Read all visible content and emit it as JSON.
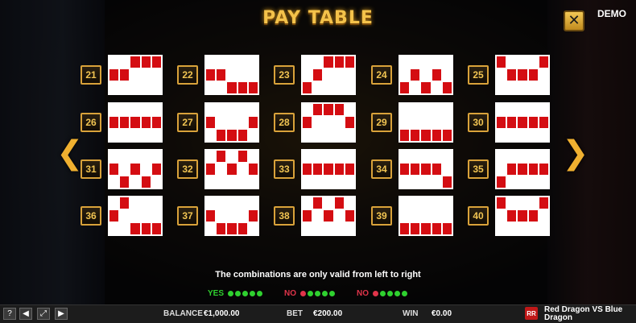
{
  "header": {
    "title": "PAY TABLE",
    "demo": "DEMO",
    "close_icon": "x-icon"
  },
  "nav": {
    "prev": "❮",
    "next": "❯"
  },
  "paylines": [
    {
      "n": "21",
      "grid": [
        [
          0,
          0,
          1,
          1,
          1
        ],
        [
          1,
          1,
          0,
          0,
          0
        ],
        [
          0,
          0,
          0,
          0,
          0
        ]
      ]
    },
    {
      "n": "22",
      "grid": [
        [
          0,
          0,
          0,
          0,
          0
        ],
        [
          1,
          1,
          0,
          0,
          0
        ],
        [
          0,
          0,
          1,
          1,
          1
        ]
      ]
    },
    {
      "n": "23",
      "grid": [
        [
          0,
          0,
          1,
          1,
          1
        ],
        [
          0,
          1,
          0,
          0,
          0
        ],
        [
          1,
          0,
          0,
          0,
          0
        ]
      ]
    },
    {
      "n": "24",
      "grid": [
        [
          0,
          0,
          0,
          0,
          0
        ],
        [
          0,
          1,
          0,
          1,
          0
        ],
        [
          1,
          0,
          1,
          0,
          1
        ]
      ]
    },
    {
      "n": "25",
      "grid": [
        [
          1,
          0,
          0,
          0,
          1
        ],
        [
          0,
          1,
          1,
          1,
          0
        ],
        [
          0,
          0,
          0,
          0,
          0
        ]
      ]
    },
    {
      "n": "26",
      "grid": [
        [
          0,
          0,
          0,
          0,
          0
        ],
        [
          1,
          1,
          1,
          1,
          1
        ],
        [
          0,
          0,
          0,
          0,
          0
        ]
      ]
    },
    {
      "n": "27",
      "grid": [
        [
          0,
          0,
          0,
          0,
          0
        ],
        [
          1,
          0,
          0,
          0,
          1
        ],
        [
          0,
          1,
          1,
          1,
          0
        ]
      ]
    },
    {
      "n": "28",
      "grid": [
        [
          0,
          1,
          1,
          1,
          0
        ],
        [
          1,
          0,
          0,
          0,
          1
        ],
        [
          0,
          0,
          0,
          0,
          0
        ]
      ]
    },
    {
      "n": "29",
      "grid": [
        [
          0,
          0,
          0,
          0,
          0
        ],
        [
          0,
          0,
          0,
          0,
          0
        ],
        [
          1,
          1,
          1,
          1,
          1
        ]
      ]
    },
    {
      "n": "30",
      "grid": [
        [
          0,
          0,
          0,
          0,
          0
        ],
        [
          1,
          1,
          1,
          1,
          1
        ],
        [
          0,
          0,
          0,
          0,
          0
        ]
      ]
    },
    {
      "n": "31",
      "grid": [
        [
          0,
          0,
          0,
          0,
          0
        ],
        [
          1,
          0,
          1,
          0,
          1
        ],
        [
          0,
          1,
          0,
          1,
          0
        ]
      ]
    },
    {
      "n": "32",
      "grid": [
        [
          0,
          1,
          0,
          1,
          0
        ],
        [
          1,
          0,
          1,
          0,
          1
        ],
        [
          0,
          0,
          0,
          0,
          0
        ]
      ]
    },
    {
      "n": "33",
      "grid": [
        [
          0,
          0,
          0,
          0,
          0
        ],
        [
          1,
          1,
          1,
          1,
          1
        ],
        [
          0,
          0,
          0,
          0,
          0
        ]
      ]
    },
    {
      "n": "34",
      "grid": [
        [
          0,
          0,
          0,
          0,
          0
        ],
        [
          1,
          1,
          1,
          1,
          0
        ],
        [
          0,
          0,
          0,
          0,
          1
        ]
      ]
    },
    {
      "n": "35",
      "grid": [
        [
          0,
          0,
          0,
          0,
          0
        ],
        [
          0,
          1,
          1,
          1,
          1
        ],
        [
          1,
          0,
          0,
          0,
          0
        ]
      ]
    },
    {
      "n": "36",
      "grid": [
        [
          0,
          1,
          0,
          0,
          0
        ],
        [
          1,
          0,
          0,
          0,
          0
        ],
        [
          0,
          0,
          1,
          1,
          1
        ]
      ]
    },
    {
      "n": "37",
      "grid": [
        [
          0,
          0,
          0,
          0,
          0
        ],
        [
          1,
          0,
          0,
          0,
          1
        ],
        [
          0,
          1,
          1,
          1,
          0
        ]
      ]
    },
    {
      "n": "38",
      "grid": [
        [
          0,
          1,
          0,
          1,
          0
        ],
        [
          1,
          0,
          1,
          0,
          1
        ],
        [
          0,
          0,
          0,
          0,
          0
        ]
      ]
    },
    {
      "n": "39",
      "grid": [
        [
          0,
          0,
          0,
          0,
          0
        ],
        [
          0,
          0,
          0,
          0,
          0
        ],
        [
          1,
          1,
          1,
          1,
          1
        ]
      ]
    },
    {
      "n": "40",
      "grid": [
        [
          1,
          0,
          0,
          0,
          1
        ],
        [
          0,
          1,
          1,
          1,
          0
        ],
        [
          0,
          0,
          0,
          0,
          0
        ]
      ]
    }
  ],
  "note": "The combinations are only valid from left to right",
  "examples": [
    {
      "label": "YES",
      "color": "#2fd12f",
      "dots": [
        "g",
        "g",
        "g",
        "g",
        "g"
      ]
    },
    {
      "label": "NO",
      "color": "#e0344a",
      "dots": [
        "r",
        "g",
        "g",
        "g",
        "g"
      ]
    },
    {
      "label": "NO",
      "color": "#e0344a",
      "dots": [
        "r",
        "g",
        "g",
        "g",
        "g"
      ]
    }
  ],
  "footer": {
    "balance_label": "BALANCE",
    "balance_value": "€1,000.00",
    "bet_label": "BET",
    "bet_value": "€200.00",
    "win_label": "WIN",
    "win_value": "€0.00",
    "game_name": "Red Dragon VS Blue Dragon",
    "logo_text": "RR",
    "icons": [
      "help-icon",
      "sound-icon",
      "fullscreen-icon",
      "play-icon"
    ],
    "icon_glyphs": [
      "?",
      "◀",
      "⤢",
      "▶"
    ]
  },
  "colors": {
    "accent": "#f4c24a",
    "line_on": "#d40d12",
    "frame": "#d9a23a"
  }
}
